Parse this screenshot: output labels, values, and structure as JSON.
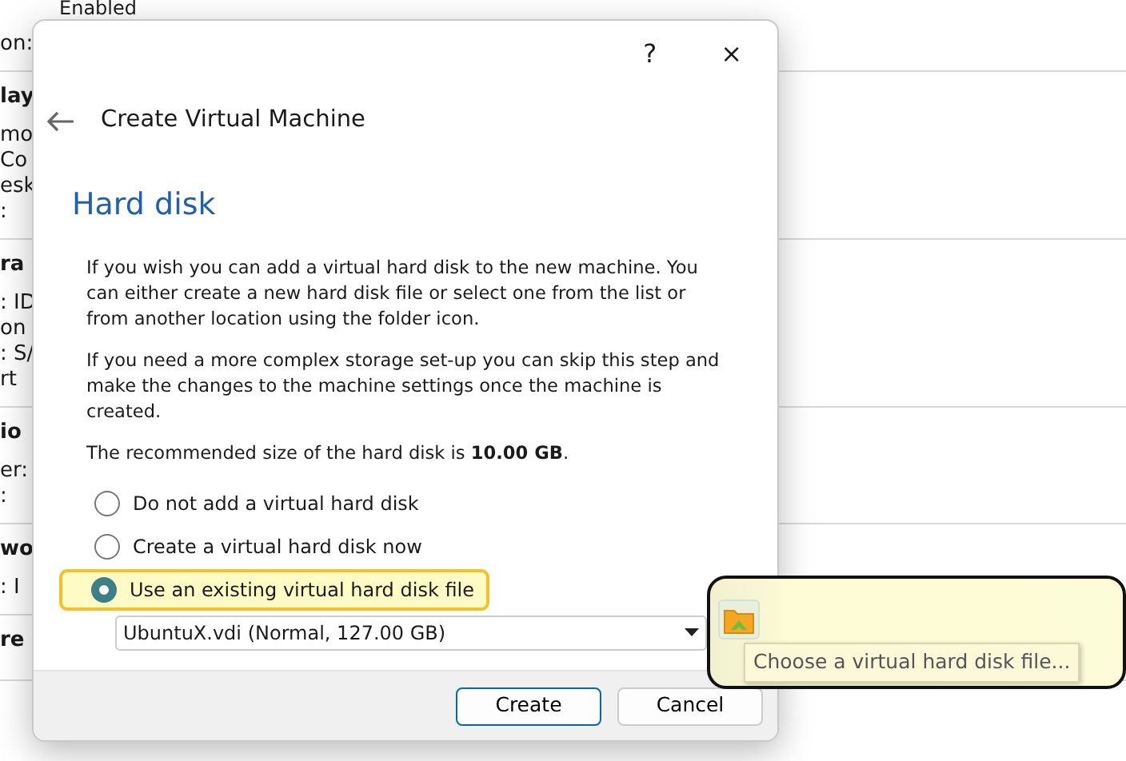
{
  "background": {
    "top_text": "Enabled",
    "sections": [
      {
        "lines": [
          "on:"
        ]
      },
      {
        "heading": "lay",
        "lines": [
          "mo",
          "Co",
          "esk",
          ":"
        ]
      },
      {
        "heading": "ra",
        "lines": [
          ": ID",
          "on",
          ": S/",
          "rt"
        ]
      },
      {
        "heading": "io",
        "lines": [
          "er:",
          ":"
        ]
      },
      {
        "heading": "wo",
        "lines": [
          ":  I"
        ]
      },
      {
        "heading": "re"
      }
    ]
  },
  "dialog": {
    "help": "?",
    "close": "×",
    "title": "Create Virtual Machine",
    "heading": "Hard disk",
    "paragraphs": [
      "If you wish you can add a virtual hard disk to the new machine. You can either create a new hard disk file or select one from the list or from another location using the folder icon.",
      "If you need a more complex storage set-up you can skip this step and make the changes to the machine settings once the machine is created.",
      "The recommended size of the hard disk is **10.00 GB**."
    ],
    "options": [
      {
        "label": "Do not add a virtual hard disk",
        "selected": false,
        "highlighted": false
      },
      {
        "label": "Create a virtual hard disk now",
        "selected": false,
        "highlighted": false
      },
      {
        "label": "Use an existing virtual hard disk file",
        "selected": true,
        "highlighted": true
      }
    ],
    "disk_select": {
      "value": "UbuntuX.vdi (Normal, 127.00 GB)",
      "disabled": false
    },
    "tooltip": "Choose a virtual hard disk file...",
    "buttons": [
      {
        "label": "Create",
        "default": true
      },
      {
        "label": "Cancel",
        "default": false
      }
    ]
  }
}
